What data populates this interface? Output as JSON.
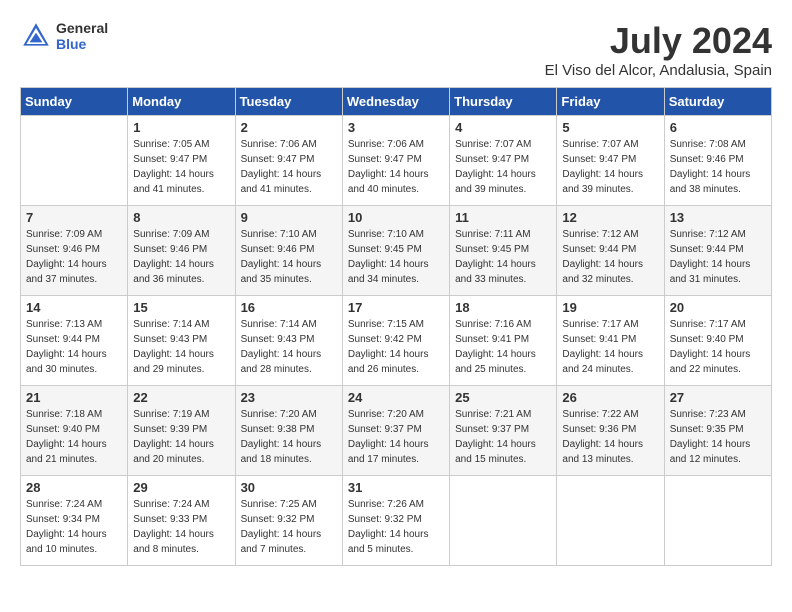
{
  "header": {
    "logo_general": "General",
    "logo_blue": "Blue",
    "month": "July 2024",
    "location": "El Viso del Alcor, Andalusia, Spain"
  },
  "days_of_week": [
    "Sunday",
    "Monday",
    "Tuesday",
    "Wednesday",
    "Thursday",
    "Friday",
    "Saturday"
  ],
  "weeks": [
    [
      {
        "day": "",
        "sunrise": "",
        "sunset": "",
        "daylight": ""
      },
      {
        "day": "1",
        "sunrise": "Sunrise: 7:05 AM",
        "sunset": "Sunset: 9:47 PM",
        "daylight": "Daylight: 14 hours and 41 minutes."
      },
      {
        "day": "2",
        "sunrise": "Sunrise: 7:06 AM",
        "sunset": "Sunset: 9:47 PM",
        "daylight": "Daylight: 14 hours and 41 minutes."
      },
      {
        "day": "3",
        "sunrise": "Sunrise: 7:06 AM",
        "sunset": "Sunset: 9:47 PM",
        "daylight": "Daylight: 14 hours and 40 minutes."
      },
      {
        "day": "4",
        "sunrise": "Sunrise: 7:07 AM",
        "sunset": "Sunset: 9:47 PM",
        "daylight": "Daylight: 14 hours and 39 minutes."
      },
      {
        "day": "5",
        "sunrise": "Sunrise: 7:07 AM",
        "sunset": "Sunset: 9:47 PM",
        "daylight": "Daylight: 14 hours and 39 minutes."
      },
      {
        "day": "6",
        "sunrise": "Sunrise: 7:08 AM",
        "sunset": "Sunset: 9:46 PM",
        "daylight": "Daylight: 14 hours and 38 minutes."
      }
    ],
    [
      {
        "day": "7",
        "sunrise": "Sunrise: 7:09 AM",
        "sunset": "Sunset: 9:46 PM",
        "daylight": "Daylight: 14 hours and 37 minutes."
      },
      {
        "day": "8",
        "sunrise": "Sunrise: 7:09 AM",
        "sunset": "Sunset: 9:46 PM",
        "daylight": "Daylight: 14 hours and 36 minutes."
      },
      {
        "day": "9",
        "sunrise": "Sunrise: 7:10 AM",
        "sunset": "Sunset: 9:46 PM",
        "daylight": "Daylight: 14 hours and 35 minutes."
      },
      {
        "day": "10",
        "sunrise": "Sunrise: 7:10 AM",
        "sunset": "Sunset: 9:45 PM",
        "daylight": "Daylight: 14 hours and 34 minutes."
      },
      {
        "day": "11",
        "sunrise": "Sunrise: 7:11 AM",
        "sunset": "Sunset: 9:45 PM",
        "daylight": "Daylight: 14 hours and 33 minutes."
      },
      {
        "day": "12",
        "sunrise": "Sunrise: 7:12 AM",
        "sunset": "Sunset: 9:44 PM",
        "daylight": "Daylight: 14 hours and 32 minutes."
      },
      {
        "day": "13",
        "sunrise": "Sunrise: 7:12 AM",
        "sunset": "Sunset: 9:44 PM",
        "daylight": "Daylight: 14 hours and 31 minutes."
      }
    ],
    [
      {
        "day": "14",
        "sunrise": "Sunrise: 7:13 AM",
        "sunset": "Sunset: 9:44 PM",
        "daylight": "Daylight: 14 hours and 30 minutes."
      },
      {
        "day": "15",
        "sunrise": "Sunrise: 7:14 AM",
        "sunset": "Sunset: 9:43 PM",
        "daylight": "Daylight: 14 hours and 29 minutes."
      },
      {
        "day": "16",
        "sunrise": "Sunrise: 7:14 AM",
        "sunset": "Sunset: 9:43 PM",
        "daylight": "Daylight: 14 hours and 28 minutes."
      },
      {
        "day": "17",
        "sunrise": "Sunrise: 7:15 AM",
        "sunset": "Sunset: 9:42 PM",
        "daylight": "Daylight: 14 hours and 26 minutes."
      },
      {
        "day": "18",
        "sunrise": "Sunrise: 7:16 AM",
        "sunset": "Sunset: 9:41 PM",
        "daylight": "Daylight: 14 hours and 25 minutes."
      },
      {
        "day": "19",
        "sunrise": "Sunrise: 7:17 AM",
        "sunset": "Sunset: 9:41 PM",
        "daylight": "Daylight: 14 hours and 24 minutes."
      },
      {
        "day": "20",
        "sunrise": "Sunrise: 7:17 AM",
        "sunset": "Sunset: 9:40 PM",
        "daylight": "Daylight: 14 hours and 22 minutes."
      }
    ],
    [
      {
        "day": "21",
        "sunrise": "Sunrise: 7:18 AM",
        "sunset": "Sunset: 9:40 PM",
        "daylight": "Daylight: 14 hours and 21 minutes."
      },
      {
        "day": "22",
        "sunrise": "Sunrise: 7:19 AM",
        "sunset": "Sunset: 9:39 PM",
        "daylight": "Daylight: 14 hours and 20 minutes."
      },
      {
        "day": "23",
        "sunrise": "Sunrise: 7:20 AM",
        "sunset": "Sunset: 9:38 PM",
        "daylight": "Daylight: 14 hours and 18 minutes."
      },
      {
        "day": "24",
        "sunrise": "Sunrise: 7:20 AM",
        "sunset": "Sunset: 9:37 PM",
        "daylight": "Daylight: 14 hours and 17 minutes."
      },
      {
        "day": "25",
        "sunrise": "Sunrise: 7:21 AM",
        "sunset": "Sunset: 9:37 PM",
        "daylight": "Daylight: 14 hours and 15 minutes."
      },
      {
        "day": "26",
        "sunrise": "Sunrise: 7:22 AM",
        "sunset": "Sunset: 9:36 PM",
        "daylight": "Daylight: 14 hours and 13 minutes."
      },
      {
        "day": "27",
        "sunrise": "Sunrise: 7:23 AM",
        "sunset": "Sunset: 9:35 PM",
        "daylight": "Daylight: 14 hours and 12 minutes."
      }
    ],
    [
      {
        "day": "28",
        "sunrise": "Sunrise: 7:24 AM",
        "sunset": "Sunset: 9:34 PM",
        "daylight": "Daylight: 14 hours and 10 minutes."
      },
      {
        "day": "29",
        "sunrise": "Sunrise: 7:24 AM",
        "sunset": "Sunset: 9:33 PM",
        "daylight": "Daylight: 14 hours and 8 minutes."
      },
      {
        "day": "30",
        "sunrise": "Sunrise: 7:25 AM",
        "sunset": "Sunset: 9:32 PM",
        "daylight": "Daylight: 14 hours and 7 minutes."
      },
      {
        "day": "31",
        "sunrise": "Sunrise: 7:26 AM",
        "sunset": "Sunset: 9:32 PM",
        "daylight": "Daylight: 14 hours and 5 minutes."
      },
      {
        "day": "",
        "sunrise": "",
        "sunset": "",
        "daylight": ""
      },
      {
        "day": "",
        "sunrise": "",
        "sunset": "",
        "daylight": ""
      },
      {
        "day": "",
        "sunrise": "",
        "sunset": "",
        "daylight": ""
      }
    ]
  ]
}
